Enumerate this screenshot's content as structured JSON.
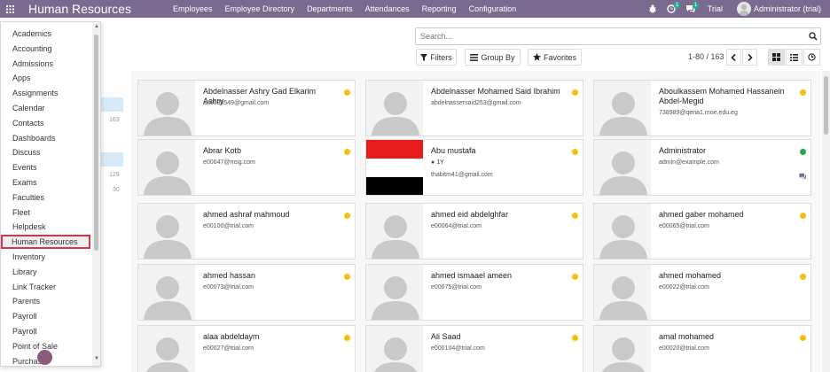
{
  "navbar": {
    "title": "Human Resources",
    "menu": [
      "Employees",
      "Employee Directory",
      "Departments",
      "Attendances",
      "Reporting",
      "Configuration"
    ],
    "activity_count": "1",
    "message_count": "1",
    "trial_label": "Trial",
    "user": "Administrator (trial)"
  },
  "search": {
    "placeholder": "Search..."
  },
  "controls": {
    "filters": "Filters",
    "group_by": "Group By",
    "favorites": "Favorites",
    "pager": "1-80 / 163"
  },
  "side_counts": [
    "163",
    "129",
    "30"
  ],
  "apps_menu": {
    "items": [
      "Academics",
      "Accounting",
      "Admissions",
      "Apps",
      "Assignments",
      "Calendar",
      "Contacts",
      "Dashboards",
      "Discuss",
      "Events",
      "Exams",
      "Faculties",
      "Fleet",
      "Helpdesk",
      "Human Resources",
      "Inventory",
      "Library",
      "Link Tracker",
      "Parents",
      "Payroll",
      "Payroll",
      "Point of Sale",
      "Purchase"
    ],
    "selected": "Human Resources"
  },
  "employees": [
    {
      "name": "Abdelnasser Ashry Gad Elkarim Ashry",
      "email": "an6033549@gmail.com",
      "status": "away"
    },
    {
      "name": "Abdelnasser Mohamed Said Ibrahim",
      "email": "abdelnassersaid253@gmail.com",
      "status": "away"
    },
    {
      "name": "Aboulkassem Mohamed Hassanein Abdel-Megid",
      "email": "738989@qena1.moe.edu.eg",
      "status": "away"
    },
    {
      "name": "Abrar Kotb",
      "email": "e00047@msg.com",
      "status": "away"
    },
    {
      "name": "Abu mustafa",
      "tag": "1Y",
      "email": "thabitm41@gmail.com",
      "status": "away",
      "photo": "flag"
    },
    {
      "name": "Administrator",
      "email": "admin@example.com",
      "status": "online"
    },
    {
      "name": "ahmed ashraf mahmoud",
      "email": "e00100@trial.com",
      "status": "away"
    },
    {
      "name": "ahmed eid abdelghfar",
      "email": "e00064@trial.com",
      "status": "away"
    },
    {
      "name": "ahmed gaber mohamed",
      "email": "e00065@trial.com",
      "status": "away"
    },
    {
      "name": "ahmed hassan",
      "email": "e00073@trial.com",
      "status": "away"
    },
    {
      "name": "ahmed ismaael ameen",
      "email": "e00075@trial.com",
      "status": "away"
    },
    {
      "name": "ahmed mohamed",
      "email": "e00022@trial.com",
      "status": "away"
    },
    {
      "name": "alaa abdeldaym",
      "email": "e00027@trial.com",
      "status": "away"
    },
    {
      "name": "Ali Saad",
      "email": "e000104@trial.com",
      "status": "away"
    },
    {
      "name": "amal mohamed",
      "email": "e00020@trial.com",
      "status": "away"
    }
  ]
}
